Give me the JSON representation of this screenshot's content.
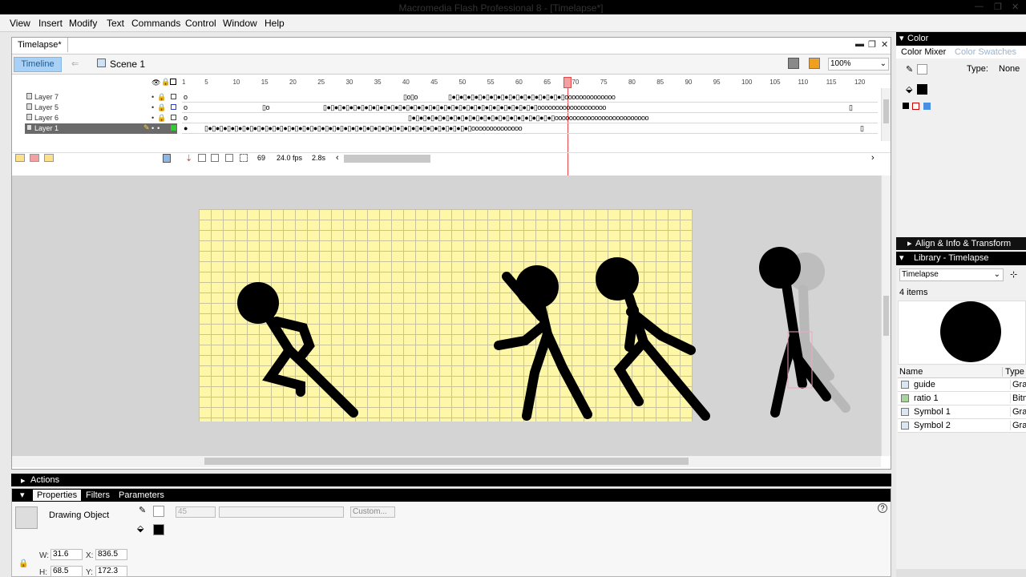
{
  "window": {
    "title": "Macromedia Flash Professional 8 - [Timelapse*]"
  },
  "menu": [
    "View",
    "Insert",
    "Modify",
    "Text",
    "Commands",
    "Control",
    "Window",
    "Help"
  ],
  "document": {
    "tab": "Timelapse*",
    "timeline_button": "Timeline",
    "scene": "Scene 1",
    "zoom": "100%"
  },
  "timeline": {
    "layers": [
      {
        "name": "Layer 7",
        "selected": false
      },
      {
        "name": "Layer 5",
        "selected": false
      },
      {
        "name": "Layer 6",
        "selected": false
      },
      {
        "name": "Layer 1",
        "selected": true
      }
    ],
    "frame_numbers": [
      "1",
      "5",
      "10",
      "15",
      "20",
      "25",
      "30",
      "35",
      "40",
      "45",
      "50",
      "55",
      "60",
      "65",
      "70",
      "75",
      "80",
      "85",
      "90",
      "95",
      "100",
      "105",
      "110",
      "115",
      "120"
    ],
    "current_frame": "69",
    "fps": "24.0 fps",
    "elapsed": "2.8s"
  },
  "actions_panel": {
    "title": "Actions"
  },
  "properties": {
    "tabs": [
      "Properties",
      "Filters",
      "Parameters"
    ],
    "object_type": "Drawing Object",
    "stroke_height": "45",
    "custom_button": "Custom...",
    "w_label": "W:",
    "w": "31.6",
    "h_label": "H:",
    "h": "68.5",
    "x_label": "X:",
    "x": "836.5",
    "y_label": "Y:",
    "y": "172.3"
  },
  "color_panel": {
    "title": "Color",
    "tabs": [
      "Color Mixer",
      "Color Swatches"
    ],
    "type_label": "Type:",
    "type_value": "None"
  },
  "align_panel": {
    "title": "Align & Info & Transform"
  },
  "library": {
    "title": "Library - Timelapse",
    "doc": "Timelapse",
    "count": "4 items",
    "col_name": "Name",
    "col_type": "Type",
    "items": [
      {
        "name": "guide",
        "type": "Grap"
      },
      {
        "name": "ratio 1",
        "type": "Bitm"
      },
      {
        "name": "Symbol 1",
        "type": "Grap"
      },
      {
        "name": "Symbol 2",
        "type": "Grap"
      }
    ]
  },
  "colors": {
    "stage_bg": "#d4d4d4",
    "grid_paper": "#fef7a8",
    "playhead": "#e8474a",
    "timeline_btn": "#a9d1f5"
  }
}
